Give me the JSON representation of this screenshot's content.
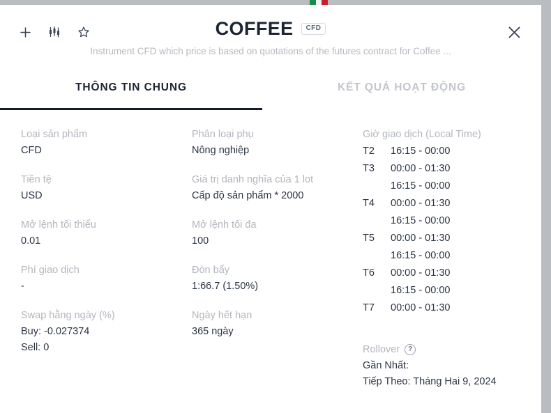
{
  "header": {
    "title": "COFFEE",
    "badge": "CFD",
    "subtitle": "Instrument CFD which price is based on quotations of the futures contract for Coffee ...",
    "actions": [
      {
        "name": "add-icon",
        "label": "+"
      },
      {
        "name": "candlestick-chart-icon",
        "label": "chart"
      },
      {
        "name": "star-favorite-icon",
        "label": "favorite"
      }
    ],
    "close_label": "close"
  },
  "tabs": [
    {
      "label": "THÔNG TIN CHUNG",
      "active": true
    },
    {
      "label": "KẾT QUẢ HOẠT ĐỘNG",
      "active": false
    }
  ],
  "columns": {
    "left": [
      {
        "label": "Loại sản phẩm",
        "value": "CFD"
      },
      {
        "label": "Tiền tệ",
        "value": "USD"
      },
      {
        "label": "Mở lệnh tối thiểu",
        "value": "0.01"
      },
      {
        "label": "Phí giao dịch",
        "value": "-"
      },
      {
        "label": "Swap hằng ngày (%)",
        "value": "Buy: -0.027374",
        "value2": "Sell: 0"
      }
    ],
    "middle": [
      {
        "label": "Phân loại phụ",
        "value": "Nông nghiệp"
      },
      {
        "label": "Giá trị danh nghĩa của 1 lot",
        "value": "Cấp độ sản phẩm * 2000"
      },
      {
        "label": "Mở lệnh tối đa",
        "value": "100"
      },
      {
        "label": "Đòn bẩy",
        "value": "1:66.7 (1.50%)"
      },
      {
        "label": "Ngày hết hạn",
        "value": "365 ngày"
      }
    ],
    "right": {
      "hours_label": "Giờ giao dịch (Local Time)",
      "hours": [
        {
          "day": "T2",
          "range": "16:15 - 00:00"
        },
        {
          "day": "T3",
          "range": "00:00 - 01:30"
        },
        {
          "day": "",
          "range": "16:15 - 00:00"
        },
        {
          "day": "T4",
          "range": "00:00 - 01:30"
        },
        {
          "day": "",
          "range": "16:15 - 00:00"
        },
        {
          "day": "T5",
          "range": "00:00 - 01:30"
        },
        {
          "day": "",
          "range": "16:15 - 00:00"
        },
        {
          "day": "T6",
          "range": "00:00 - 01:30"
        },
        {
          "day": "",
          "range": "16:15 - 00:00"
        },
        {
          "day": "T7",
          "range": "00:00 - 01:30"
        }
      ],
      "rollover_label": "Rollover",
      "rollover_help": "?",
      "rollover_last": "Gần Nhất:",
      "rollover_next": "Tiếp Theo: Tháng Hai 9, 2024"
    }
  },
  "colors": {
    "title": "#1c2433",
    "label": "#b3b6bd",
    "value": "#2b3443",
    "tab_active": "#141c2b",
    "tab_inactive": "#c3c6cc",
    "backdrop": "#b9bcc1",
    "accent_red": "#9b1f31"
  }
}
